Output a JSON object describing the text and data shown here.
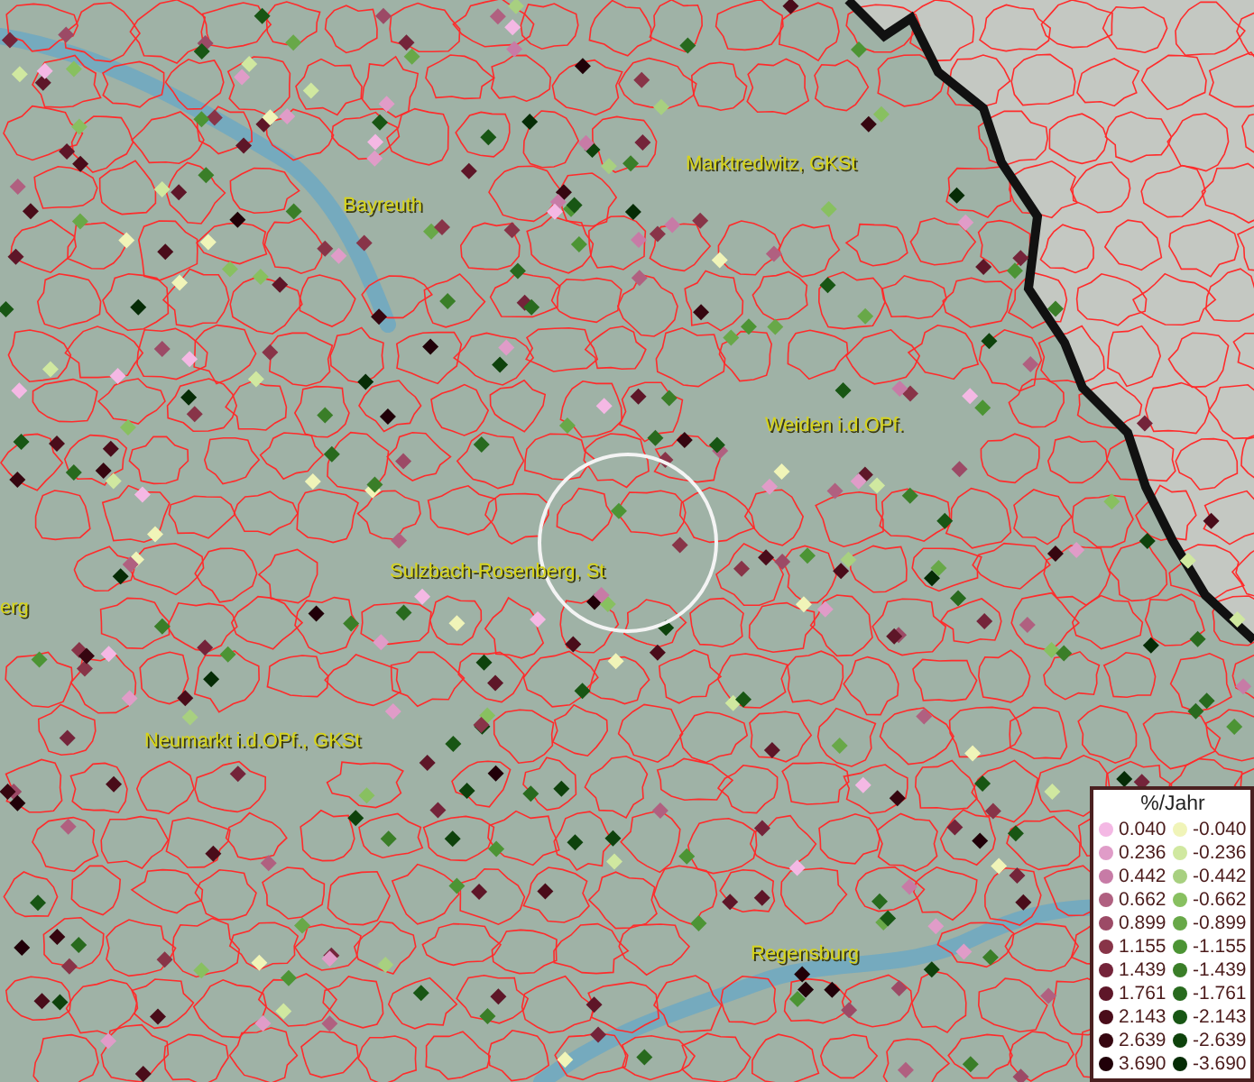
{
  "map": {
    "places": [
      {
        "label": "Marktredwitz, GKSt"
      },
      {
        "label": "Bayreuth"
      },
      {
        "label": "Weiden i.d.OPf."
      },
      {
        "label": "Sulzbach-Rosenberg, St"
      },
      {
        "label": "erg"
      },
      {
        "label": "Neumarkt i.d.OPf., GKSt"
      },
      {
        "label": "Regensburg"
      }
    ]
  },
  "legend": {
    "title": "%/Jahr",
    "rows": [
      {
        "positive": {
          "value": "0.040",
          "color": "#f4b8e4"
        },
        "negative": {
          "value": "-0.040",
          "color": "#f0f4b8"
        }
      },
      {
        "positive": {
          "value": "0.236",
          "color": "#e09cc8"
        },
        "negative": {
          "value": "-0.236",
          "color": "#d0e8a0"
        }
      },
      {
        "positive": {
          "value": "0.442",
          "color": "#c77ba6"
        },
        "negative": {
          "value": "-0.442",
          "color": "#a8d080"
        }
      },
      {
        "positive": {
          "value": "0.662",
          "color": "#b06080"
        },
        "negative": {
          "value": "-0.662",
          "color": "#88c060"
        }
      },
      {
        "positive": {
          "value": "0.899",
          "color": "#9c4a66"
        },
        "negative": {
          "value": "-0.899",
          "color": "#68a848"
        }
      },
      {
        "positive": {
          "value": "1.155",
          "color": "#883448"
        },
        "negative": {
          "value": "-1.155",
          "color": "#4c9434"
        }
      },
      {
        "positive": {
          "value": "1.439",
          "color": "#74243a"
        },
        "negative": {
          "value": "-1.439",
          "color": "#3a7e28"
        }
      },
      {
        "positive": {
          "value": "1.761",
          "color": "#5e1628"
        },
        "negative": {
          "value": "-1.761",
          "color": "#286a1e"
        }
      },
      {
        "positive": {
          "value": "2.143",
          "color": "#4a0c1a"
        },
        "negative": {
          "value": "-2.143",
          "color": "#185614"
        }
      },
      {
        "positive": {
          "value": "2.639",
          "color": "#360610"
        },
        "negative": {
          "value": "-2.639",
          "color": "#0e420c"
        }
      },
      {
        "positive": {
          "value": "3.690",
          "color": "#200008"
        },
        "negative": {
          "value": "-3.690",
          "color": "#062c06"
        }
      }
    ]
  }
}
